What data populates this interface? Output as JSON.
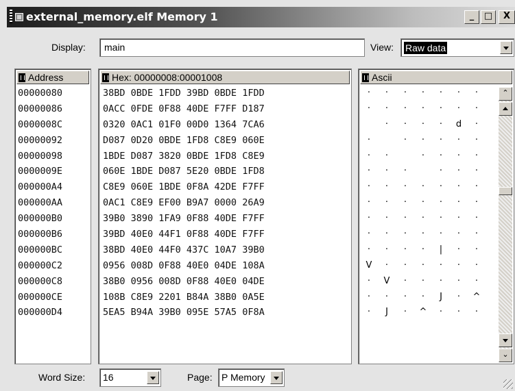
{
  "window": {
    "title": "external_memory.elf Memory 1",
    "minimize_label": "_",
    "maximize_label": "□",
    "close_label": "X"
  },
  "display": {
    "label": "Display:",
    "value": "main"
  },
  "view": {
    "label": "View:",
    "value": "Raw data"
  },
  "columns": {
    "address": "Address",
    "hex": "Hex: 00000008:00001008",
    "ascii": "Ascii"
  },
  "addresses": [
    "00000080",
    "00000086",
    "0000008C",
    "00000092",
    "00000098",
    "0000009E",
    "000000A4",
    "000000AA",
    "000000B0",
    "000000B6",
    "000000BC",
    "000000C2",
    "000000C8",
    "000000CE",
    "000000D4"
  ],
  "hex_rows": [
    "38BD 0BDE 1FDD 39BD 0BDE 1FDD",
    "0ACC 0FDE 0F88 40DE F7FF D187",
    "0320 0AC1 01F0 00D0 1364 7CA6",
    "D087 0D20 0BDE 1FD8 C8E9 060E",
    "1BDE D087 3820 0BDE 1FD8 C8E9",
    "060E 1BDE D087 5E20 0BDE 1FD8",
    "C8E9 060E 1BDE 0F8A 42DE F7FF",
    "0AC1 C8E9 EF00 B9A7 0000 26A9",
    "39B0 3890 1FA9 0F88 40DE F7FF",
    "39BD 40E0 44F1 0F88 40DE F7FF",
    "38BD 40E0 44F0 437C 10A7 39B0",
    "0956 008D 0F88 40E0 04DE 108A",
    "38B0 0956 008D 0F88 40E0 04DE",
    "108B C8E9 2201 B84A 38B0 0A5E",
    "5EA5 B94A 39B0 095E 57A5 0F8A"
  ],
  "ascii_rows": [
    [
      "·",
      "·",
      "·",
      "·",
      "·",
      "·",
      "·"
    ],
    [
      "·",
      "·",
      "·",
      "·",
      "·",
      "·",
      "·"
    ],
    [
      " ",
      "·",
      "·",
      "·",
      "·",
      "d",
      "·"
    ],
    [
      "·",
      " ",
      "·",
      "·",
      "·",
      "·",
      "·"
    ],
    [
      "·",
      "·",
      " ",
      "·",
      "·",
      "·",
      "·"
    ],
    [
      "·",
      "·",
      "·",
      " ",
      "·",
      "·",
      "·"
    ],
    [
      "·",
      "·",
      "·",
      "·",
      "·",
      "·",
      "·"
    ],
    [
      "·",
      "·",
      "·",
      "·",
      "·",
      "·",
      "·"
    ],
    [
      "·",
      "·",
      "·",
      "·",
      "·",
      "·",
      "·"
    ],
    [
      "·",
      "·",
      "·",
      "·",
      "·",
      "·",
      "·"
    ],
    [
      "·",
      "·",
      "·",
      "·",
      "|",
      "·",
      "·"
    ],
    [
      "V",
      "·",
      "·",
      "·",
      "·",
      "·",
      "·"
    ],
    [
      "·",
      "V",
      "·",
      "·",
      "·",
      "·",
      "·"
    ],
    [
      "·",
      "·",
      "·",
      "·",
      "J",
      "·",
      "^"
    ],
    [
      "·",
      "J",
      "·",
      "^",
      "·",
      "·",
      "·"
    ]
  ],
  "word_size": {
    "label": "Word Size:",
    "value": "16"
  },
  "page": {
    "label": "Page:",
    "value": "P Memory"
  }
}
